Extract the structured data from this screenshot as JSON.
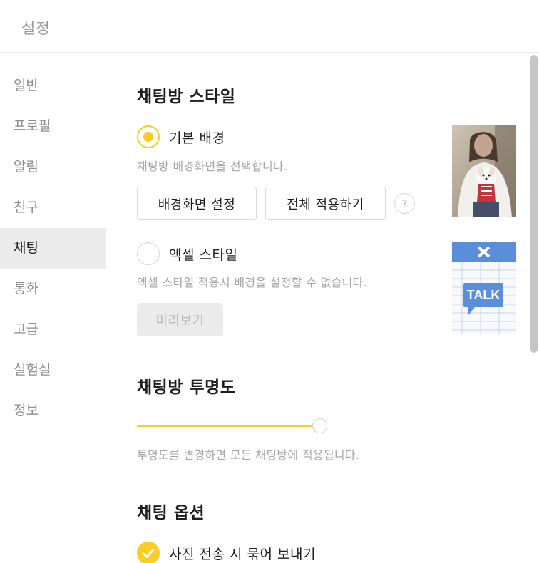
{
  "window": {
    "title": "설정"
  },
  "sidebar": {
    "items": [
      {
        "label": "일반"
      },
      {
        "label": "프로필"
      },
      {
        "label": "알림"
      },
      {
        "label": "친구"
      },
      {
        "label": "채팅",
        "active": true
      },
      {
        "label": "통화"
      },
      {
        "label": "고급"
      },
      {
        "label": "실험실"
      },
      {
        "label": "정보"
      }
    ]
  },
  "chat_style": {
    "title": "채팅방 스타일",
    "default_bg": {
      "label": "기본 배경",
      "selected": true,
      "description": "채팅방 배경화면을 선택합니다.",
      "set_bg_button": "배경화면 설정",
      "apply_all_button": "전체 적용하기",
      "help_icon": "?"
    },
    "excel_style": {
      "label": "엑셀 스타일",
      "selected": false,
      "description": "엑셀 스타일 적용시 배경을 설정할 수 없습니다.",
      "preview_button": "미리보기",
      "thumb_text": "TALK"
    }
  },
  "transparency": {
    "title": "채팅방 투명도",
    "value_percent": 100,
    "description": "투명도를 변경하면 모든 채팅방에 적용됩니다."
  },
  "chat_options": {
    "title": "채팅 옵션",
    "bundle_photos": {
      "label": "사진 전송 시 묶어 보내기",
      "checked": true
    }
  },
  "colors": {
    "accent": "#fbcc26",
    "active_bg": "#ebebeb"
  }
}
